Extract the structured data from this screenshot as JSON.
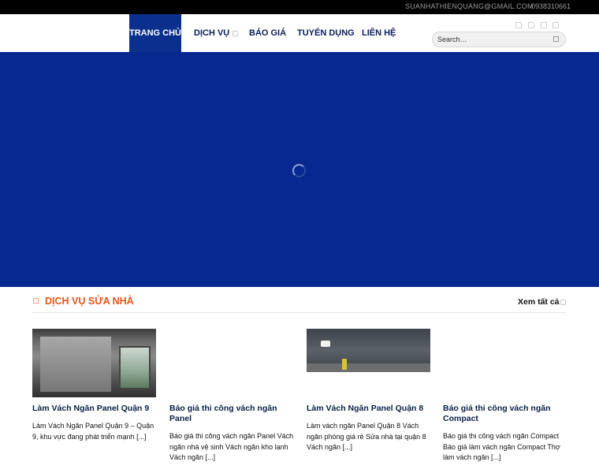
{
  "topbar": {
    "email": "SUANHATHIENQUANG@GMAIL.COM",
    "phone": "0938310661"
  },
  "nav": {
    "items": [
      {
        "label": "TRANG CHỦ",
        "active": true
      },
      {
        "label": "DỊCH VỤ",
        "has_caret": true
      },
      {
        "label": "BÁO GIÁ"
      },
      {
        "label": "TUYỂN DỤNG"
      },
      {
        "label": "LIÊN HỆ"
      }
    ],
    "caret_icon": "chevron-down-icon"
  },
  "social_icons": [
    "facebook-icon",
    "instagram-icon",
    "twitter-icon",
    "email-icon"
  ],
  "search": {
    "placeholder": "Search…",
    "value": ""
  },
  "hero": {
    "background_color": "#07288e",
    "loading": true
  },
  "section": {
    "title": "DỊCH VỤ SỬA NHÀ",
    "view_all": "Xem tất cả",
    "title_color": "#e8541a"
  },
  "posts": [
    {
      "title": "Làm Vách Ngăn Panel Quận 9",
      "excerpt": "Làm Vách Ngăn Panel Quận 9 – Quận 9, khu vực đang phát triển mạnh [...]",
      "has_image": true
    },
    {
      "title": "Báo giá thi công vách ngăn Panel",
      "excerpt": "Báo giá thi công vách ngăn Panel Vách ngăn nhà vệ sinh Vách ngăn kho lạnh Vách ngăn [...]",
      "has_image": false
    },
    {
      "title": "Làm Vách Ngăn Panel Quận 8",
      "excerpt": "Làm vách ngăn Panel Quận 8 Vách ngăn phòng giá rẻ Sửa nhà tại quận 8 Vách ngăn [...]",
      "has_image": true
    },
    {
      "title": "Báo giá thi công vách ngăn Compact",
      "excerpt": "Báo giá thi công vách ngăn Compact Báo giá làm vách ngăn Compact Thợ làm vách ngăn [...]",
      "has_image": false
    }
  ],
  "colors": {
    "nav_active": "#0b2f8c",
    "nav_text": "#0a1f5c",
    "accent": "#e8541a"
  }
}
